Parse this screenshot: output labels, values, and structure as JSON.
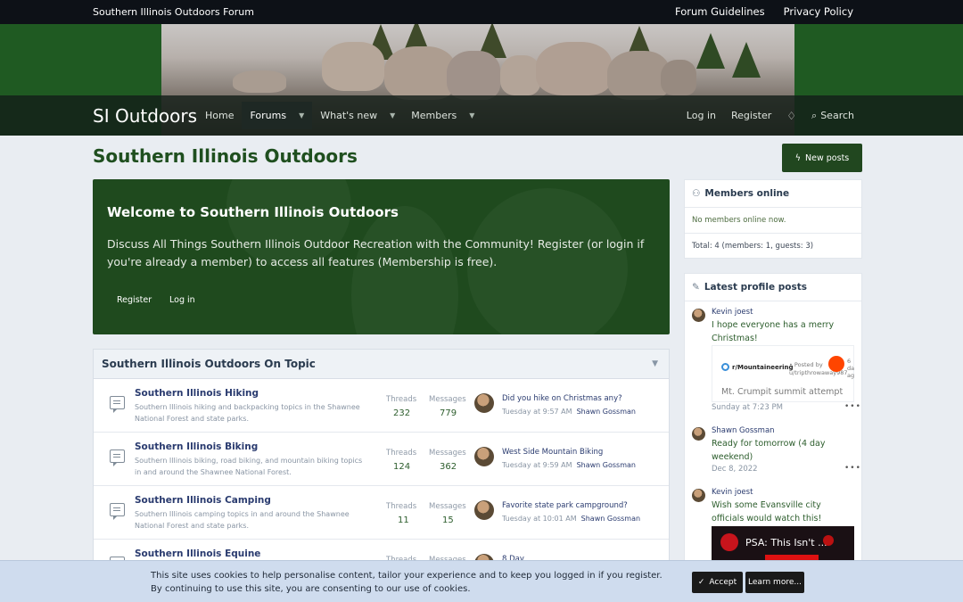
{
  "topbar": {
    "site_name": "Southern Illinois Outdoors Forum",
    "links": [
      "Forum Guidelines",
      "Privacy Policy"
    ]
  },
  "nav": {
    "brand": "SI Outdoors",
    "items": [
      {
        "label": "Home"
      },
      {
        "label": "Forums"
      },
      {
        "label": "What's new"
      },
      {
        "label": "Members"
      }
    ],
    "login": "Log in",
    "register": "Register",
    "search": "Search"
  },
  "page": {
    "title": "Southern Illinois Outdoors",
    "new_posts": "New posts"
  },
  "welcome": {
    "heading": "Welcome to Southern Illinois Outdoors",
    "text": "Discuss All Things Southern Illinois Outdoor Recreation with the Community! Register (or login if you're already a member) to access all features (Membership is free).",
    "register": "Register",
    "login": "Log in"
  },
  "forum_section": {
    "title": "Southern Illinois Outdoors On Topic",
    "threads_label": "Threads",
    "messages_label": "Messages",
    "rows": [
      {
        "name": "Southern Illinois Hiking",
        "desc": "Southern Illinois hiking and backpacking topics in the Shawnee National Forest and state parks.",
        "threads": "232",
        "messages": "779",
        "last_title": "Did you hike on Christmas any?",
        "last_time": "Tuesday at 9:57 AM",
        "last_user": "Shawn Gossman"
      },
      {
        "name": "Southern Illinois Biking",
        "desc": "Southern Illinois biking, road biking, and mountain biking topics in and around the Shawnee National Forest.",
        "threads": "124",
        "messages": "362",
        "last_title": "West Side Mountain Biking",
        "last_time": "Tuesday at 9:59 AM",
        "last_user": "Shawn Gossman"
      },
      {
        "name": "Southern Illinois Camping",
        "desc": "Southern Illinois camping topics in and around the Shawnee National Forest and state parks.",
        "threads": "11",
        "messages": "15",
        "last_title": "Favorite state park campground?",
        "last_time": "Tuesday at 10:01 AM",
        "last_user": "Shawn Gossman"
      },
      {
        "name": "Southern Illinois Equine",
        "desc": "",
        "threads": "",
        "messages": "",
        "last_title": "8 Day",
        "last_time": "",
        "last_user": ""
      }
    ]
  },
  "members_online": {
    "title": "Members online",
    "none": "No members online now.",
    "total": "Total: 4 (members: 1, guests: 3)"
  },
  "profile_posts": {
    "title": "Latest profile posts",
    "posts": [
      {
        "user": "Kevin joest",
        "text": "I hope everyone has a merry Christmas!",
        "date": "Sunday at 7:23 PM"
      },
      {
        "user": "Shawn Gossman",
        "text": "Ready for tomorrow (4 day weekend)",
        "date": "Dec 8, 2022"
      },
      {
        "user": "Kevin joest",
        "text": "Wish some Evansville city officials would watch this!",
        "date": ""
      }
    ],
    "embed": {
      "subreddit": "r/Mountaineering",
      "posted_by": "• Posted by",
      "posted_user": "u/tripthrowaway987",
      "age_1": "6",
      "age_2": "da",
      "age_3": "ag",
      "title": "Mt. Crumpit summit attempt"
    },
    "video_title": "PSA: This Isn't ..."
  },
  "cookie": {
    "line1": "This site uses cookies to help personalise content, tailor your experience and to keep you logged in if you register.",
    "line2": "By continuing to use this site, you are consenting to our use of cookies.",
    "accept": "Accept",
    "learn_more": "Learn more..."
  }
}
